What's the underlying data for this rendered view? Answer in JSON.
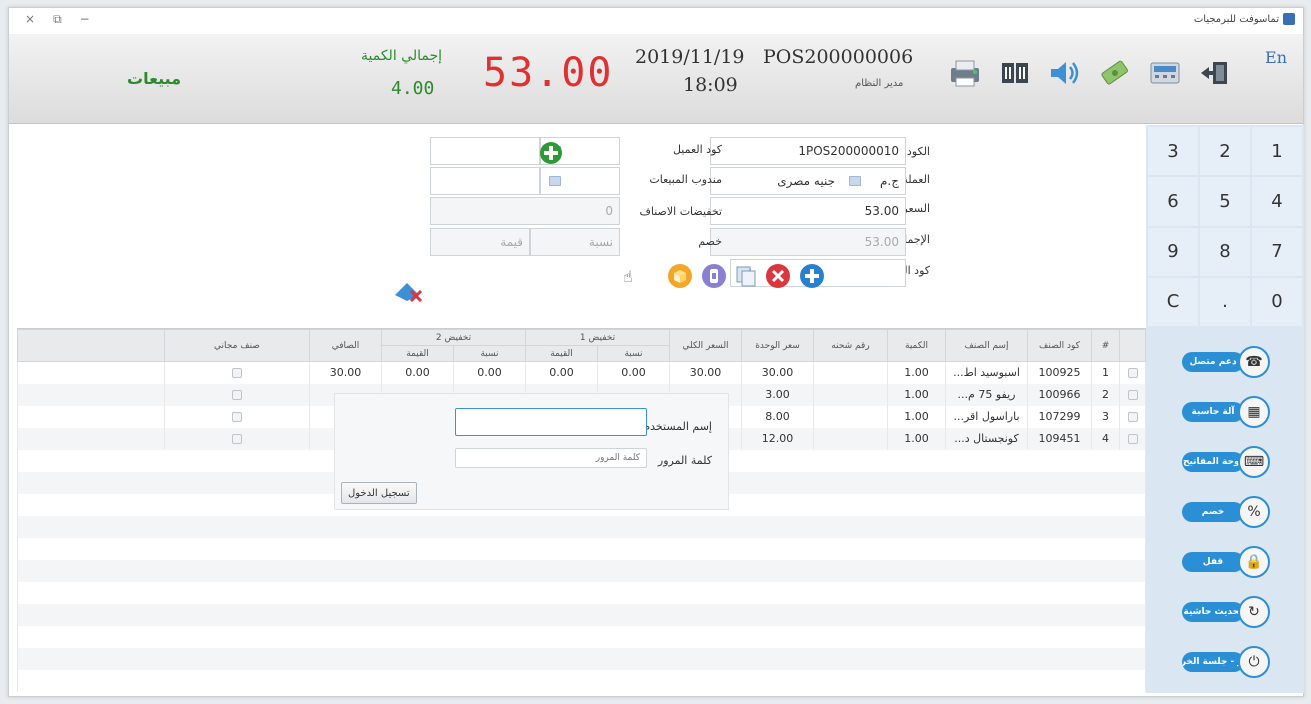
{
  "window": {
    "title": "تماسوفت للبرمجيات",
    "controls": [
      "×",
      "⧉",
      "−"
    ]
  },
  "header": {
    "sales_label": "مبيعات",
    "qty_title": "إجمالي الكمية",
    "qty_value": "4.00",
    "total": "53.00",
    "date": "2019/11/19",
    "time": "18:09",
    "pos_id": "POS200000006",
    "user": "مدير النظام",
    "lang": "En",
    "icons": [
      "printer-icon",
      "barcode-icon",
      "speaker-icon",
      "money-icon",
      "calculator-icon",
      "exit-icon"
    ]
  },
  "form": {
    "code_label": "الكود",
    "code_value": "1POS200000010",
    "currency_label": "العملة",
    "currency_value": "جنيه مصرى",
    "currency_abbr": "ج.م",
    "total_price_label": "السعر الكلي",
    "total_price_value": "53.00",
    "net_label": "الإجمالي",
    "net_value": "53.00",
    "item_code_label": "كود الصنف",
    "customer_code_label": "كود العميل",
    "sales_rep_label": "مندوب المبيعات",
    "item_discounts_label": "تخفيضات الاصناف",
    "item_discounts_value": "0",
    "discount_label": "خصم",
    "percent_placeholder": "نسبة",
    "value_placeholder": "قيمة"
  },
  "numpad": [
    "3",
    "2",
    "1",
    "6",
    "5",
    "4",
    "9",
    "8",
    "7",
    "C",
    ".",
    "0"
  ],
  "grid": {
    "group_headers": {
      "discount1": "تخفيض 1",
      "discount2": "تخفيض 2"
    },
    "headers": {
      "num": "#",
      "item_code": "كود الصنف",
      "item_name": "إسم الصنف",
      "qty": "الكمية",
      "batch": "رقم شحنه",
      "unit_price": "سعر الوحدة",
      "total_price": "السعر الكلي",
      "d1_pct": "نسبة",
      "d1_val": "القيمة",
      "d2_pct": "نسبة",
      "d2_val": "القيمة",
      "net": "الصافي",
      "free_item": "صنف مجاني"
    },
    "rows": [
      {
        "num": "1",
        "code": "100925",
        "name": "اسبوسيد اط...",
        "qty": "1.00",
        "unit_price": "30.00",
        "total": "30.00",
        "d1_pct": "0.00",
        "d1_val": "0.00",
        "d2_pct": "0.00",
        "d2_val": "0.00",
        "net": "30.00"
      },
      {
        "num": "2",
        "code": "100966",
        "name": "ريفو 75 م...",
        "qty": "1.00",
        "unit_price": "3.00",
        "total": "",
        "d1_pct": "",
        "d1_val": "",
        "d2_pct": "",
        "d2_val": "",
        "net": ""
      },
      {
        "num": "3",
        "code": "107299",
        "name": "باراسول اقر...",
        "qty": "1.00",
        "unit_price": "8.00",
        "total": "",
        "d1_pct": "",
        "d1_val": "",
        "d2_pct": "",
        "d2_val": "",
        "net": ""
      },
      {
        "num": "4",
        "code": "109451",
        "name": "كونجستال د...",
        "qty": "1.00",
        "unit_price": "12.00",
        "total": "",
        "d1_pct": "",
        "d1_val": "",
        "d2_pct": "",
        "d2_val": "",
        "net": ""
      }
    ]
  },
  "login": {
    "username_label": "إسم المستخدم",
    "password_label": "كلمة المرور",
    "password_placeholder": "كلمة المرور",
    "login_button": "تسجيل الدخول"
  },
  "sidebar": {
    "buttons": [
      "دعم متصل",
      "آلة حاسبة",
      "لوحة المفاتيح",
      "خصم",
      "قفل",
      "تحديث حاشية",
      "مدير - جلسة الخروج"
    ]
  }
}
